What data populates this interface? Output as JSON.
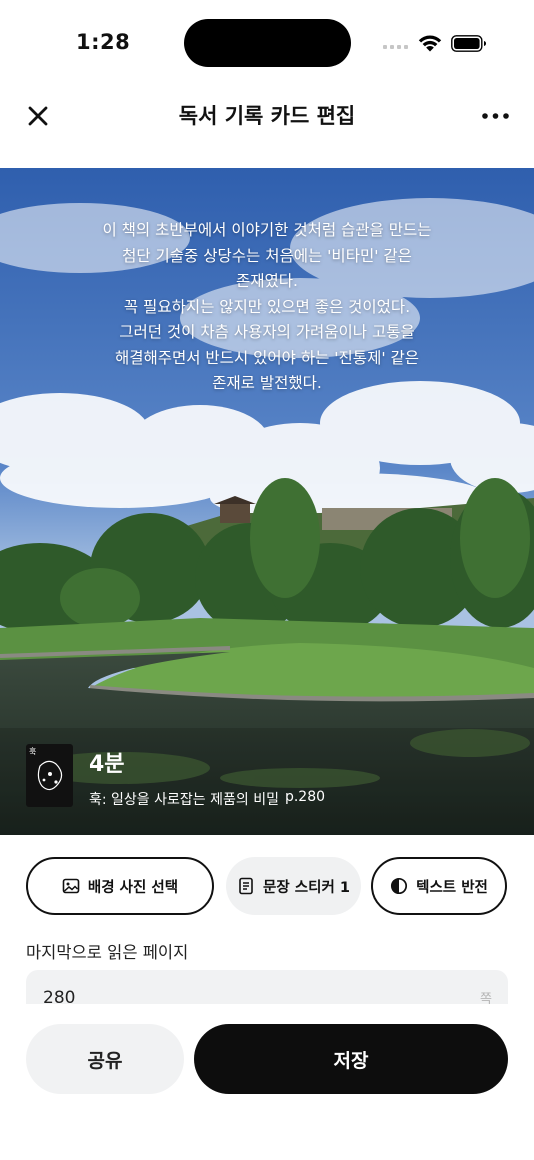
{
  "status_bar": {
    "time": "1:28"
  },
  "nav": {
    "title": "독서 기록 카드 편집",
    "close_icon": "close-icon",
    "more_icon": "more-icon"
  },
  "card": {
    "quote": "이 책의 초반부에서 이야기한 것처럼 습관을 만드는\n첨단 기술중 상당수는 처음에는 '비타민' 같은\n존재였다.\n꼭 필요하지는 않지만 있으면 좋은 것이었다.\n그러던 것이 차츰 사용자의 가려움이나 고통을\n해결해주면서 반드시 있어야 하는 '진통제' 같은\n존재로 발전했다.",
    "book_cover_text": "훅",
    "reading_time": "4분",
    "book_title": "훅: 일상을 사로잡는 제품의 비밀",
    "page_ref": "p.280"
  },
  "actions": {
    "background_photo": "배경 사진 선택",
    "sentence_sticker": "문장 스티커 1",
    "invert_text": "텍스트 반전"
  },
  "last_page": {
    "label": "마지막으로 읽은 페이지",
    "value": "280",
    "unit": "쪽"
  },
  "footer": {
    "share": "공유",
    "save": "저장"
  }
}
